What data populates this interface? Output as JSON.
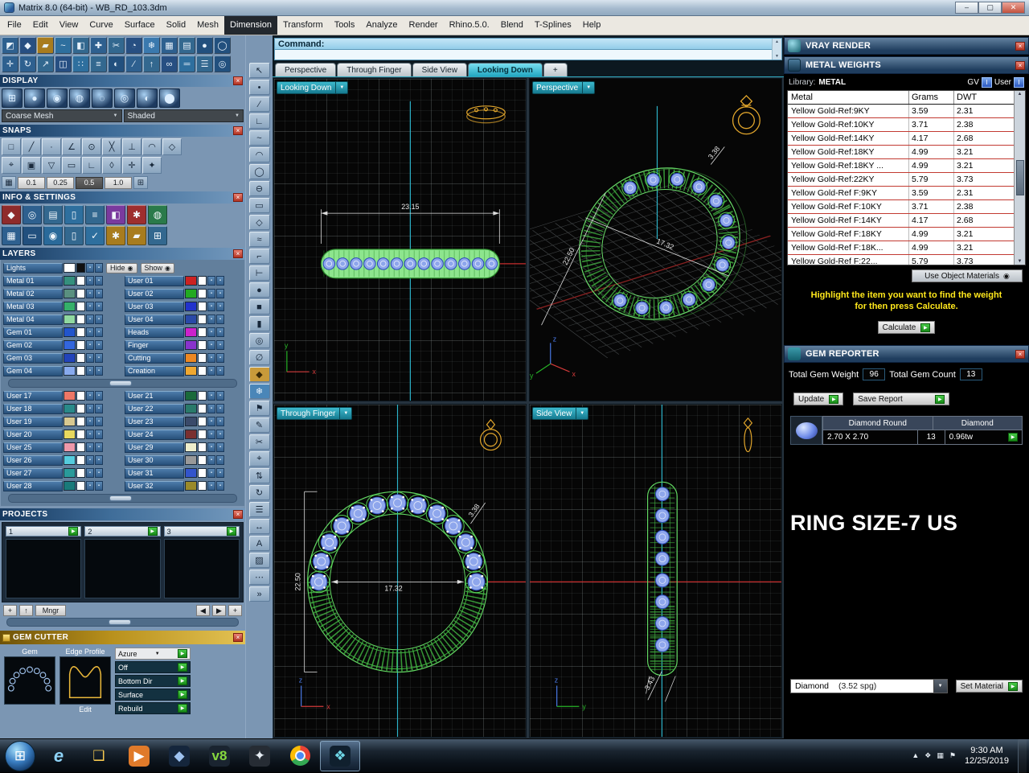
{
  "window": {
    "title": "Matrix 8.0 (64-bit) - WB_RD_103.3dm",
    "minimize": "–",
    "maximize": "▢",
    "close": "✕"
  },
  "menus": [
    {
      "n": "menu-file",
      "label": "File"
    },
    {
      "n": "menu-edit",
      "label": "Edit"
    },
    {
      "n": "menu-view",
      "label": "View"
    },
    {
      "n": "menu-curve",
      "label": "Curve"
    },
    {
      "n": "menu-surface",
      "label": "Surface"
    },
    {
      "n": "menu-solid",
      "label": "Solid"
    },
    {
      "n": "menu-mesh",
      "label": "Mesh"
    },
    {
      "n": "menu-dimension",
      "label": "Dimension",
      "active": true
    },
    {
      "n": "menu-transform",
      "label": "Transform"
    },
    {
      "n": "menu-tools",
      "label": "Tools"
    },
    {
      "n": "menu-analyze",
      "label": "Analyze"
    },
    {
      "n": "menu-render",
      "label": "Render"
    },
    {
      "n": "menu-rhino",
      "label": "Rhino.5.0."
    },
    {
      "n": "menu-blend",
      "label": "Blend"
    },
    {
      "n": "menu-tsplines",
      "label": "T-Splines"
    },
    {
      "n": "menu-help",
      "label": "Help"
    }
  ],
  "command": {
    "label": "Command:"
  },
  "tabs": [
    {
      "label": "Perspective"
    },
    {
      "label": "Through Finger"
    },
    {
      "label": "Side View"
    },
    {
      "label": "Looking Down",
      "active": true
    },
    {
      "label": "+"
    }
  ],
  "viewports": {
    "looking_down": {
      "label": "Looking Down",
      "dim": "23.15"
    },
    "perspective": {
      "label": "Perspective",
      "dim_w": "17.32",
      "dim_h": "22.50",
      "dim_s": "3.38"
    },
    "through_finger": {
      "label": "Through Finger",
      "dim_w": "17.32",
      "dim_h": "22.50",
      "dim_s": "3.38"
    },
    "side_view": {
      "label": "Side View",
      "dim": "3.43"
    }
  },
  "axes": {
    "x": "x",
    "y": "y",
    "z": "z"
  },
  "left": {
    "toolbar_row1": [
      {
        "n": "select-tool-icon",
        "g": "◩",
        "c": "#2e608f"
      },
      {
        "n": "gem-loader-icon",
        "g": "◆",
        "c": "#274f82"
      },
      {
        "n": "metal-library-icon",
        "g": "▰",
        "c": "#a87c1e"
      },
      {
        "n": "curve-tool-icon",
        "g": "~",
        "c": "#2e6f9e"
      },
      {
        "n": "surface-tool-icon",
        "g": "◧",
        "c": "#33688f"
      },
      {
        "n": "builder-tool-icon",
        "g": "✚",
        "c": "#2e608f"
      },
      {
        "n": "cutter-tool-icon",
        "g": "✂",
        "c": "#33688f"
      },
      {
        "n": "profile-tool-icon",
        "g": "◔",
        "c": "#274f82"
      },
      {
        "n": "render-tool-icon",
        "g": "❄",
        "c": "#3a79ae"
      },
      {
        "n": "grid-tool-icon",
        "g": "▦",
        "c": "#2e608f"
      },
      {
        "n": "panel-tool-icon",
        "g": "▤",
        "c": "#33688f"
      },
      {
        "n": "sphere-tool-icon",
        "g": "●",
        "c": "#22507e"
      },
      {
        "n": "circle-tool-icon",
        "g": "◯",
        "c": "#22507e"
      }
    ],
    "toolbar_row2": [
      {
        "n": "move-tool-icon",
        "g": "✛",
        "c": "#2e608f"
      },
      {
        "n": "rotate-tool-icon",
        "g": "↻",
        "c": "#2e608f"
      },
      {
        "n": "scale-tool-icon",
        "g": "↗",
        "c": "#33688f"
      },
      {
        "n": "mirror-tool-icon",
        "g": "◫",
        "c": "#274f82"
      },
      {
        "n": "array-tool-icon",
        "g": "∷",
        "c": "#2e6f9e"
      },
      {
        "n": "align-tool-icon",
        "g": "≡",
        "c": "#33688f"
      },
      {
        "n": "boolean-tool-icon",
        "g": "◐",
        "c": "#22507e"
      },
      {
        "n": "trim-tool-icon",
        "g": "∕",
        "c": "#2e608f"
      },
      {
        "n": "extrude-tool-icon",
        "g": "↑",
        "c": "#33688f"
      },
      {
        "n": "sweep-tool-icon",
        "g": "∞",
        "c": "#274f82"
      },
      {
        "n": "pipe-tool-icon",
        "g": "═",
        "c": "#2e6f9e"
      },
      {
        "n": "history-tool-icon",
        "g": "☰",
        "c": "#33688f"
      },
      {
        "n": "options-tool-icon",
        "g": "◎",
        "c": "#22507e"
      }
    ],
    "display": {
      "title": "DISPLAY",
      "modes": [
        {
          "n": "wireframe-mode-icon",
          "g": "⊞"
        },
        {
          "n": "shaded-mode-icon",
          "g": "●"
        },
        {
          "n": "rendered-mode-icon",
          "g": "◉"
        },
        {
          "n": "ghosted-mode-icon",
          "g": "◍"
        },
        {
          "n": "xray-mode-icon",
          "g": "◌"
        },
        {
          "n": "technical-mode-icon",
          "g": "◎"
        },
        {
          "n": "artistic-mode-icon",
          "g": "◐"
        },
        {
          "n": "pen-mode-icon",
          "g": "⬤"
        }
      ],
      "dropdown_mesh": "Coarse Mesh",
      "dropdown_shade": "Shaded"
    },
    "snaps": {
      "title": "SNAPS",
      "row1": [
        {
          "n": "end-snap-icon",
          "g": "□"
        },
        {
          "n": "near-snap-icon",
          "g": "╱"
        },
        {
          "n": "point-snap-icon",
          "g": "·"
        },
        {
          "n": "mid-snap-icon",
          "g": "∠"
        },
        {
          "n": "center-snap-icon",
          "g": "⊙"
        },
        {
          "n": "intersection-snap-icon",
          "g": "╳"
        },
        {
          "n": "perpendicular-snap-icon",
          "g": "⊥"
        },
        {
          "n": "tangent-snap-icon",
          "g": "◠"
        },
        {
          "n": "quadrant-snap-icon",
          "g": "◇"
        }
      ],
      "row2": [
        {
          "n": "knot-snap-icon",
          "g": "⌖"
        },
        {
          "n": "vertex-snap-icon",
          "g": "▣"
        },
        {
          "n": "project-snap-icon",
          "g": "▽"
        },
        {
          "n": "disable-snap-icon",
          "g": "▭"
        },
        {
          "n": "ortho-snap-icon",
          "g": "∟"
        },
        {
          "n": "planar-snap-icon",
          "g": "◊"
        },
        {
          "n": "osnap-snap-icon",
          "g": "✛"
        },
        {
          "n": "smarttrack-snap-icon",
          "g": "✦"
        }
      ],
      "left_icon": "▦",
      "right_icon": "⊞",
      "values": [
        {
          "label": "0.1"
        },
        {
          "label": "0.25"
        },
        {
          "label": "0.5",
          "active": true
        },
        {
          "label": "1.0"
        }
      ]
    },
    "info": {
      "title": "INFO & SETTINGS",
      "row1": [
        {
          "n": "gem-report-icon",
          "g": "◆",
          "c": "#8f2b2b"
        },
        {
          "n": "magnifier-icon",
          "g": "◎",
          "c": "#2e608f"
        },
        {
          "n": "printer-icon",
          "g": "▤",
          "c": "#33688f"
        },
        {
          "n": "document-icon",
          "g": "▯",
          "c": "#2e6f9e"
        },
        {
          "n": "notes-icon",
          "g": "≡",
          "c": "#33688f"
        },
        {
          "n": "palette-icon",
          "g": "◧",
          "c": "#7a3a9e"
        },
        {
          "n": "analyze-icon",
          "g": "✱",
          "c": "#9e2e2e"
        },
        {
          "n": "environment-icon",
          "g": "◍",
          "c": "#2a7a4a"
        }
      ],
      "row2": [
        {
          "n": "grid-settings-icon",
          "g": "▦",
          "c": "#2e608f"
        },
        {
          "n": "display-settings-icon",
          "g": "▭",
          "c": "#22507e"
        },
        {
          "n": "globe-icon",
          "g": "◉",
          "c": "#2a6a9a"
        },
        {
          "n": "page-settings-icon",
          "g": "▯",
          "c": "#33688f"
        },
        {
          "n": "check-icon",
          "g": "✓",
          "c": "#2e6f9e"
        },
        {
          "n": "gear-icon",
          "g": "✱",
          "c": "#a87c1e"
        },
        {
          "n": "gold-bar-icon",
          "g": "▰",
          "c": "#a87c1e"
        },
        {
          "n": "calculator-icon",
          "g": "⊞",
          "c": "#33688f"
        }
      ]
    },
    "layers": {
      "title": "LAYERS",
      "hide_label": "Hide",
      "show_label": "Show",
      "lights": {
        "name": "Lights",
        "color": "#ffffff",
        "alt": "#101010"
      },
      "g1_left": [
        {
          "name": "Metal 01",
          "color": "#35907d"
        },
        {
          "name": "Metal 02",
          "color": "#5a9080"
        },
        {
          "name": "Metal 03",
          "color": "#35b06a"
        },
        {
          "name": "Metal 04",
          "color": "#90d8a0"
        },
        {
          "name": "Gem 01",
          "color": "#2255cc"
        },
        {
          "name": "Gem 02",
          "color": "#3366dd"
        },
        {
          "name": "Gem 03",
          "color": "#2244bb"
        },
        {
          "name": "Gem 04",
          "color": "#88aaee"
        }
      ],
      "g1_right": [
        {
          "name": "User 01",
          "color": "#cc2222"
        },
        {
          "name": "User 02",
          "color": "#22aa22"
        },
        {
          "name": "User 03",
          "color": "#2233cc"
        },
        {
          "name": "User 04",
          "color": "#2a49a8"
        },
        {
          "name": "Heads",
          "color": "#cc22cc"
        },
        {
          "name": "Finger",
          "color": "#8833cc"
        },
        {
          "name": "Cutting",
          "color": "#ee8822"
        },
        {
          "name": "Creation",
          "color": "#f0a830"
        }
      ],
      "g2_left": [
        {
          "name": "User 17",
          "color": "#ee7766"
        },
        {
          "name": "User 18",
          "color": "#2a8a8a"
        },
        {
          "name": "User 19",
          "color": "#d8c890"
        },
        {
          "name": "User 20",
          "color": "#e8d85e"
        },
        {
          "name": "User 25",
          "color": "#ee99aa"
        },
        {
          "name": "User 26",
          "color": "#55ccdd"
        },
        {
          "name": "User 27",
          "color": "#2a9a9a"
        },
        {
          "name": "User 28",
          "color": "#1a7a7a"
        }
      ],
      "g2_right": [
        {
          "name": "User 21",
          "color": "#1a6a3a"
        },
        {
          "name": "User 22",
          "color": "#2a7a6a"
        },
        {
          "name": "User 23",
          "color": "#3a4a6a"
        },
        {
          "name": "User 24",
          "color": "#7a3030"
        },
        {
          "name": "User 29",
          "color": "#eeeecc"
        },
        {
          "name": "User 30",
          "color": "#999999"
        },
        {
          "name": "User 31",
          "color": "#3355cc"
        },
        {
          "name": "User 32",
          "color": "#9a8a2a"
        }
      ]
    },
    "projects": {
      "title": "PROJECTS",
      "slots": [
        {
          "num": "1"
        },
        {
          "num": "2"
        },
        {
          "num": "3"
        }
      ],
      "mngr": "Mngr"
    },
    "gem_cutter": {
      "title": "GEM CUTTER",
      "gem_label": "Gem",
      "edge_label": "Edge Profile",
      "edit_label": "Edit",
      "options": [
        {
          "n": "gc-azure-option",
          "label": "Azure",
          "light": true,
          "caret": true
        },
        {
          "n": "gc-off-option",
          "label": "Off"
        },
        {
          "n": "gc-bottom-dir-option",
          "label": "Bottom Dir",
          "arrow": true
        },
        {
          "n": "gc-surface-option",
          "label": "Surface",
          "arrow": true
        },
        {
          "n": "gc-rebuild-option",
          "label": "Rebuild",
          "arrow": true
        }
      ]
    }
  },
  "strip": [
    {
      "n": "pointer-icon",
      "g": "↖"
    },
    {
      "n": "point-icon",
      "g": "•"
    },
    {
      "n": "line-icon",
      "g": "∕"
    },
    {
      "n": "polyline-icon",
      "g": "∟"
    },
    {
      "n": "curve-icon",
      "g": "~"
    },
    {
      "n": "arc-icon",
      "g": "◠"
    },
    {
      "n": "circle-icon",
      "g": "◯"
    },
    {
      "n": "ellipse-icon",
      "g": "⊖"
    },
    {
      "n": "rectangle-icon",
      "g": "▭"
    },
    {
      "n": "polygon-icon",
      "g": "◇"
    },
    {
      "n": "offset-icon",
      "g": "≈"
    },
    {
      "n": "fillet-icon",
      "g": "⌐"
    },
    {
      "n": "extend-icon",
      "g": "⊢"
    },
    {
      "n": "sphere-icon",
      "g": "●"
    },
    {
      "n": "box-icon",
      "g": "■"
    },
    {
      "n": "cylinder-icon",
      "g": "▮"
    },
    {
      "n": "torus-icon",
      "g": "◎"
    },
    {
      "n": "pipe-icon",
      "g": "∅"
    },
    {
      "n": "gem-icon",
      "g": "◆",
      "c": "#c89a3a",
      "fg": "#3a2a08"
    },
    {
      "n": "snowflake-icon",
      "g": "❄",
      "c": "#4a86b8",
      "fg": "#eaf4fc"
    },
    {
      "n": "flag-icon",
      "g": "⚑"
    },
    {
      "n": "pen-icon",
      "g": "✎"
    },
    {
      "n": "scissors-icon",
      "g": "✂"
    },
    {
      "n": "target-icon",
      "g": "⌖"
    },
    {
      "n": "swap-icon",
      "g": "⇅"
    },
    {
      "n": "refresh-icon",
      "g": "↻"
    },
    {
      "n": "layers-strip-icon",
      "g": "☰"
    },
    {
      "n": "dimension-icon",
      "g": "↔"
    },
    {
      "n": "text-icon",
      "g": "A"
    },
    {
      "n": "hatch-icon",
      "g": "▨"
    },
    {
      "n": "ellipsis-icon",
      "g": "⋯"
    },
    {
      "n": "more-icon",
      "g": "»"
    }
  ],
  "right": {
    "vray": {
      "title": "VRAY RENDER"
    },
    "metal": {
      "title": "METAL WEIGHTS",
      "library_label": "Library:",
      "library_value": "METAL",
      "gv": "GV",
      "user": "User",
      "col_metal": "Metal",
      "col_grams": "Grams",
      "col_dwt": "DWT",
      "rows": [
        {
          "metal": "Yellow Gold-Ref:9KY",
          "grams": "3.59",
          "dwt": "2.31"
        },
        {
          "metal": "Yellow Gold-Ref:10KY",
          "grams": "3.71",
          "dwt": "2.38"
        },
        {
          "metal": "Yellow Gold-Ref:14KY",
          "grams": "4.17",
          "dwt": "2.68"
        },
        {
          "metal": "Yellow Gold-Ref:18KY",
          "grams": "4.99",
          "dwt": "3.21"
        },
        {
          "metal": "Yellow Gold-Ref:18KY ...",
          "grams": "4.99",
          "dwt": "3.21"
        },
        {
          "metal": "Yellow Gold-Ref:22KY",
          "grams": "5.79",
          "dwt": "3.73"
        },
        {
          "metal": "Yellow Gold-Ref F:9KY",
          "grams": "3.59",
          "dwt": "2.31"
        },
        {
          "metal": "Yellow Gold-Ref F:10KY",
          "grams": "3.71",
          "dwt": "2.38"
        },
        {
          "metal": "Yellow Gold-Ref F:14KY",
          "grams": "4.17",
          "dwt": "2.68"
        },
        {
          "metal": "Yellow Gold-Ref F:18KY",
          "grams": "4.99",
          "dwt": "3.21"
        },
        {
          "metal": "Yellow Gold-Ref F:18K...",
          "grams": "4.99",
          "dwt": "3.21"
        },
        {
          "metal": "Yellow Gold-Ref F:22...",
          "grams": "5.79",
          "dwt": "3.73"
        }
      ],
      "use_obj": "Use Object Materials",
      "instr1": "Highlight the item you want to find the weight",
      "instr2": "for then press Calculate.",
      "calculate": "Calculate"
    },
    "reporter": {
      "title": "GEM REPORTER",
      "w_label": "Total Gem Weight",
      "w_value": "96",
      "c_label": "Total Gem Count",
      "c_value": "13",
      "update": "Update",
      "save": "Save Report",
      "g_type": "Diamond Round",
      "g_mat": "Diamond",
      "g_size": "2.70 X 2.70",
      "g_count": "13",
      "g_tw": "0.96tw",
      "ring_size": "RING SIZE-7 US",
      "mat_name": "Diamond",
      "mat_spg": "(3.52 spg)",
      "set_material": "Set Material"
    }
  },
  "taskbar": {
    "start_glyph": "⊞",
    "icons": [
      {
        "n": "internet-explorer-icon",
        "g": "e",
        "fg": "#8fd4f8",
        "italic": true
      },
      {
        "n": "file-explorer-icon",
        "g": "❑",
        "fg": "#f5c84f"
      },
      {
        "n": "media-player-icon",
        "g": "▶",
        "fg": "#ffffff",
        "bg": "#e07a2a"
      },
      {
        "n": "matrix-app-icon",
        "g": "◆",
        "fg": "#9ec2f0",
        "bg": "#15263c"
      },
      {
        "n": "v8-app-icon",
        "g": "v8",
        "fg": "#86d83e",
        "bg": "#1a2430"
      },
      {
        "n": "keyshot-app-icon",
        "g": "✦",
        "fg": "#e8eef4",
        "bg": "#262c34"
      },
      {
        "n": "chrome-icon",
        "chrome": true
      },
      {
        "n": "matrix-paint-icon",
        "g": "❖",
        "fg": "#6fd8e8",
        "bg": "#10202e",
        "active": true
      }
    ],
    "tray": [
      {
        "n": "tray-expand-icon",
        "g": "▲"
      },
      {
        "n": "tray-app-icon",
        "g": "❖"
      },
      {
        "n": "tray-network-icon",
        "g": "▦"
      },
      {
        "n": "tray-flag-icon",
        "g": "⚑"
      }
    ],
    "time": "9:30 AM",
    "date": "12/25/2019"
  },
  "ui": {
    "close": "×",
    "caret_down": "▼",
    "play": "▶",
    "radio": "◉",
    "up": "↑",
    "plus": "+",
    "left": "◀",
    "right": "▶",
    "dot": "▪",
    "scroll_up": "▲",
    "scroll_down": "▼"
  }
}
